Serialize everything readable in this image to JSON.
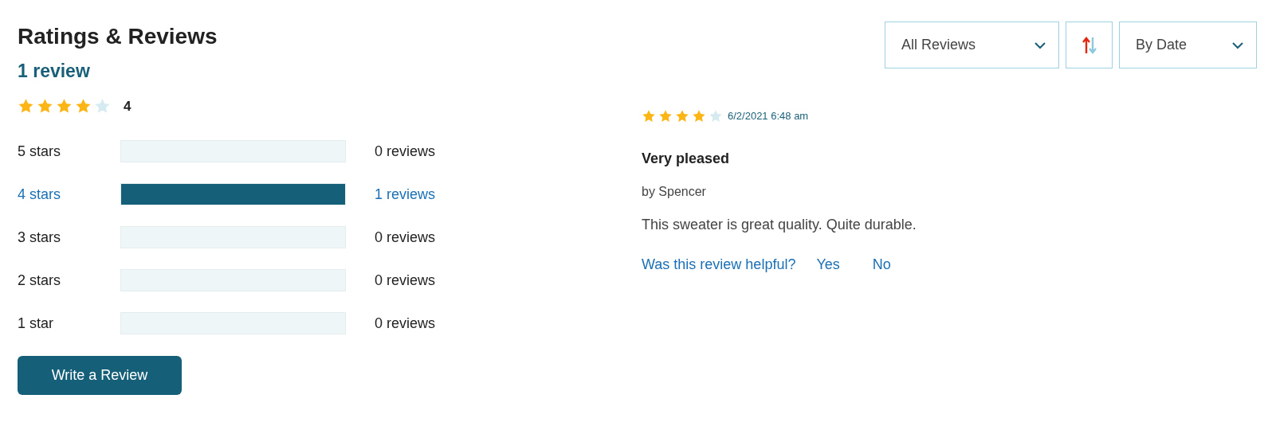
{
  "title": "Ratings & Reviews",
  "review_count": "1 review",
  "summary": {
    "stars": 4,
    "average": "4"
  },
  "histogram": [
    {
      "label": "5 stars",
      "level": 0,
      "count": "0 reviews",
      "active": false
    },
    {
      "label": "4 stars",
      "level": 1,
      "count": "1 reviews",
      "active": true
    },
    {
      "label": "3 stars",
      "level": 0,
      "count": "0 reviews",
      "active": false
    },
    {
      "label": "2 stars",
      "level": 0,
      "count": "0 reviews",
      "active": false
    },
    {
      "label": "1 star",
      "level": 0,
      "count": "0 reviews",
      "active": false
    }
  ],
  "write_button": "Write a Review",
  "filters": {
    "filter": "All Reviews",
    "sort": "By Date"
  },
  "reviews": [
    {
      "stars": 4,
      "date": "6/2/2021 6:48 am",
      "title": "Very pleased",
      "author": "by Spencer",
      "body": "This sweater is great quality. Quite durable.",
      "helpful": {
        "question": "Was this review helpful?",
        "yes": "Yes",
        "no": "No"
      }
    }
  ]
}
